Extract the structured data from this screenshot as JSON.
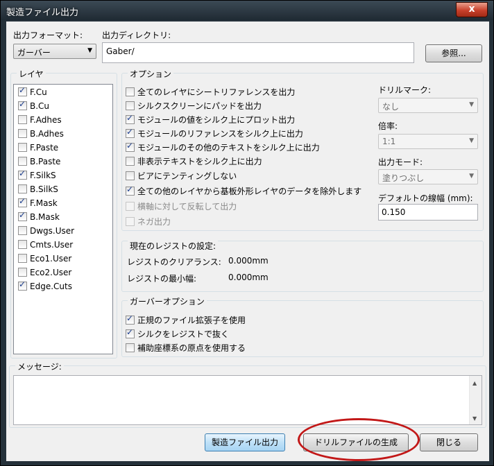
{
  "window": {
    "title": "製造ファイル出力",
    "close_glyph": "x"
  },
  "format": {
    "label": "出力フォーマット:",
    "value": "ガーバー"
  },
  "directory": {
    "label": "出力ディレクトリ:",
    "value": "Gaber/",
    "browse_label": "参照..."
  },
  "layers": {
    "label": "レイヤ",
    "items": [
      {
        "name": "F.Cu",
        "checked": true
      },
      {
        "name": "B.Cu",
        "checked": true
      },
      {
        "name": "F.Adhes",
        "checked": false
      },
      {
        "name": "B.Adhes",
        "checked": false
      },
      {
        "name": "F.Paste",
        "checked": false
      },
      {
        "name": "B.Paste",
        "checked": false
      },
      {
        "name": "F.SilkS",
        "checked": true
      },
      {
        "name": "B.SilkS",
        "checked": false
      },
      {
        "name": "F.Mask",
        "checked": true
      },
      {
        "name": "B.Mask",
        "checked": true
      },
      {
        "name": "Dwgs.User",
        "checked": false
      },
      {
        "name": "Cmts.User",
        "checked": false
      },
      {
        "name": "Eco1.User",
        "checked": false
      },
      {
        "name": "Eco2.User",
        "checked": false
      },
      {
        "name": "Edge.Cuts",
        "checked": true
      }
    ]
  },
  "options": {
    "label": "オプション",
    "items": [
      {
        "label": "全てのレイヤにシートリファレンスを出力",
        "checked": false,
        "enabled": true
      },
      {
        "label": "シルクスクリーンにパッドを出力",
        "checked": false,
        "enabled": true
      },
      {
        "label": "モジュールの値をシルク上にプロット出力",
        "checked": true,
        "enabled": true
      },
      {
        "label": "モジュールのリファレンスをシルク上に出力",
        "checked": true,
        "enabled": true
      },
      {
        "label": "モジュールのその他のテキストをシルク上に出力",
        "checked": true,
        "enabled": true
      },
      {
        "label": "非表示テキストをシルク上に出力",
        "checked": false,
        "enabled": true
      },
      {
        "label": "ビアにテンティングしない",
        "checked": false,
        "enabled": true
      },
      {
        "label": "全ての他のレイヤから基板外形レイヤのデータを除外します",
        "checked": true,
        "enabled": true
      },
      {
        "label": "横軸に対して反転して出力",
        "checked": false,
        "enabled": false
      },
      {
        "label": "ネガ出力",
        "checked": false,
        "enabled": false
      }
    ],
    "drill_mark": {
      "label": "ドリルマーク:",
      "value": "なし"
    },
    "scale": {
      "label": "倍率:",
      "value": "1:1"
    },
    "output_mode": {
      "label": "出力モード:",
      "value": "塗りつぶし"
    },
    "line_width": {
      "label": "デフォルトの線幅 (mm):",
      "value": "0.150"
    }
  },
  "resist": {
    "label": "現在のレジストの設定:",
    "clearance_label": "レジストのクリアランス:",
    "clearance_value": "0.000mm",
    "min_width_label": "レジストの最小幅:",
    "min_width_value": "0.000mm"
  },
  "gerber": {
    "label": "ガーバーオプション",
    "items": [
      {
        "label": "正規のファイル拡張子を使用",
        "checked": true
      },
      {
        "label": "シルクをレジストで抜く",
        "checked": true
      },
      {
        "label": "補助座標系の原点を使用する",
        "checked": false
      }
    ]
  },
  "messages": {
    "label": "メッセージ:"
  },
  "buttons": {
    "plot": "製造ファイル出力",
    "drill": "ドリルファイルの生成",
    "close": "閉じる"
  },
  "highlight_color": "#c21818"
}
